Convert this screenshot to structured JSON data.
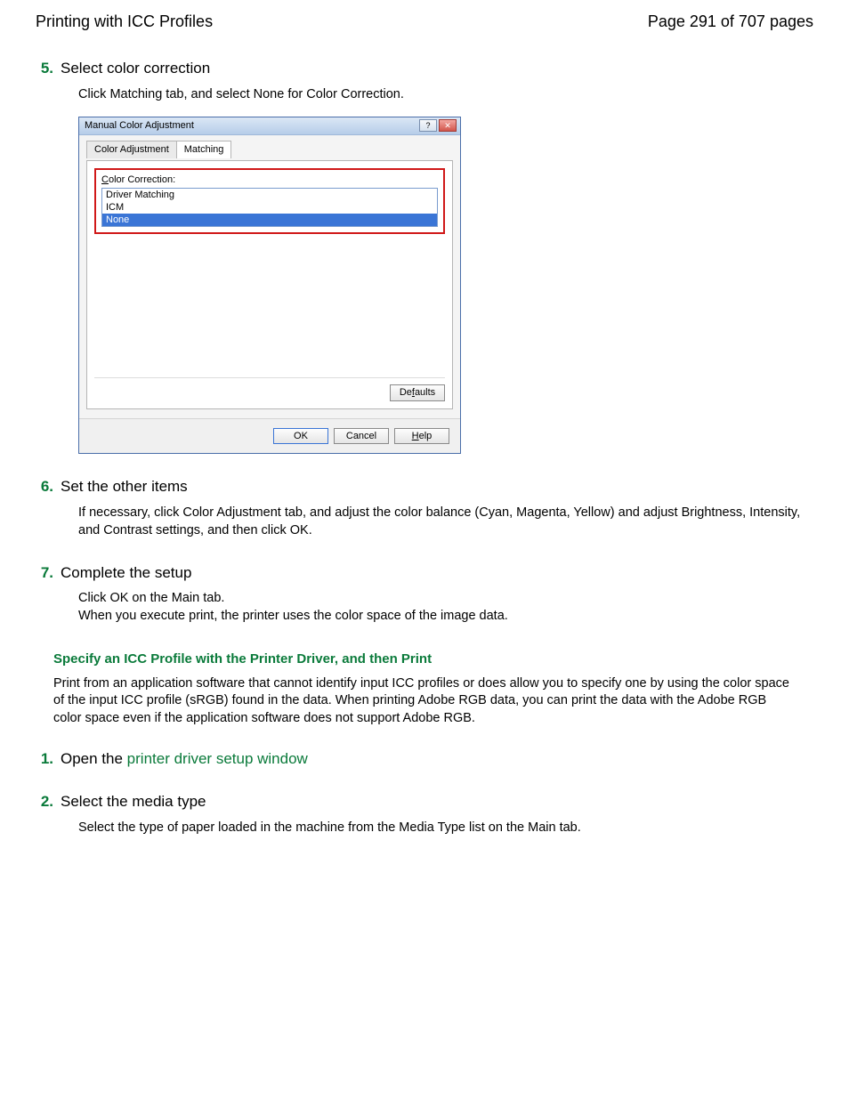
{
  "header": {
    "title": "Printing with ICC Profiles",
    "page_indicator": "Page 291 of 707 pages"
  },
  "steps_a": [
    {
      "num": "5.",
      "title": "Select color correction",
      "body": "Click Matching tab, and select None for Color Correction."
    },
    {
      "num": "6.",
      "title": "Set the other items",
      "body": "If necessary, click Color Adjustment tab, and adjust the color balance (Cyan, Magenta, Yellow) and adjust Brightness, Intensity, and Contrast settings, and then click OK."
    },
    {
      "num": "7.",
      "title": "Complete the setup",
      "body": "Click OK on the Main tab.\nWhen you execute print, the printer uses the color space of the image data."
    }
  ],
  "section": {
    "heading": "Specify an ICC Profile with the Printer Driver, and then Print",
    "desc": "Print from an application software that cannot identify input ICC profiles or does allow you to specify one by using the color space of the input ICC profile (sRGB) found in the data. When printing Adobe RGB data, you can print the data with the Adobe RGB color space even if the application software does not support Adobe RGB."
  },
  "steps_b": [
    {
      "num": "1.",
      "title_prefix": "Open the ",
      "title_link": "printer driver setup window",
      "body": ""
    },
    {
      "num": "2.",
      "title": "Select the media type",
      "body": "Select the type of paper loaded in the machine from the Media Type list on the Main tab."
    }
  ],
  "dialog": {
    "title": "Manual Color Adjustment",
    "tabs": {
      "inactive": "Color Adjustment",
      "active": "Matching"
    },
    "cc_label_u": "C",
    "cc_label_rest": "olor Correction:",
    "options": [
      "Driver Matching",
      "ICM",
      "None"
    ],
    "selected_index": 2,
    "defaults_btn_u": "f",
    "defaults_btn_pre": "De",
    "defaults_btn_post": "aults",
    "ok": "OK",
    "cancel": "Cancel",
    "help_u": "H",
    "help_rest": "elp",
    "winhelp": "?",
    "winclose": "✕"
  }
}
